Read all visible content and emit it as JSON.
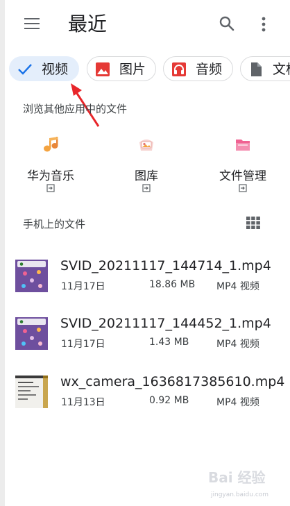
{
  "header": {
    "title": "最近"
  },
  "chips": [
    {
      "label": "视频",
      "icon": "check-icon",
      "active": true
    },
    {
      "label": "图片",
      "icon": "image-icon",
      "color": "#e53935"
    },
    {
      "label": "音频",
      "icon": "headphones-icon",
      "color": "#e53935"
    },
    {
      "label": "文档",
      "icon": "document-icon",
      "color": "#5f6368"
    }
  ],
  "other_apps": {
    "heading": "浏览其他应用中的文件",
    "apps": [
      {
        "name": "华为音乐",
        "icon": "music-app-icon"
      },
      {
        "name": "图库",
        "icon": "gallery-app-icon"
      },
      {
        "name": "文件管理",
        "icon": "file-manager-app-icon"
      }
    ]
  },
  "phone_files": {
    "heading": "手机上的文件",
    "files": [
      {
        "name": "SVID_20211117_144714_1.mp4",
        "date": "11月17日",
        "size": "18.86 MB",
        "type": "MP4 视频"
      },
      {
        "name": "SVID_20211117_144452_1.mp4",
        "date": "11月17日",
        "size": "1.43 MB",
        "type": "MP4 视频"
      },
      {
        "name": "wx_camera_1636817385610.mp4",
        "date": "11月13日",
        "size": "0.92 MB",
        "type": "MP4 视频"
      }
    ]
  },
  "watermark": {
    "logo": "Bai 经验",
    "url": "jingyan.baidu.com"
  },
  "colors": {
    "accent": "#1a73e8",
    "active_chip_bg": "#e4eefb",
    "annotation_arrow": "#e8262a"
  }
}
